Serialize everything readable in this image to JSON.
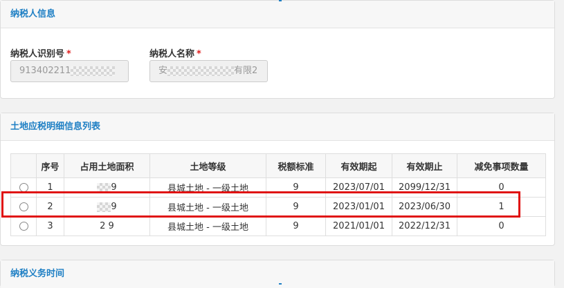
{
  "taxpayer_info": {
    "title": "纳税人信息",
    "id_label": "纳税人识别号",
    "id_value": "913402211",
    "name_label": "纳税人名称",
    "name_prefix": "安",
    "name_suffix": "有限2",
    "required_mark": "*"
  },
  "land_list": {
    "title": "土地应税明细信息列表",
    "columns": [
      "",
      "序号",
      "占用土地面积",
      "土地等级",
      "税额标准",
      "有效期起",
      "有效期止",
      "减免事项数量"
    ],
    "rows": [
      {
        "seq": "1",
        "area": "9",
        "grade": "县城土地 - 一级土地",
        "rate": "9",
        "start": "2023/07/01",
        "end": "2099/12/31",
        "count": "0"
      },
      {
        "seq": "2",
        "area": "9",
        "grade": "县城土地 - 一级土地",
        "rate": "9",
        "start": "2023/01/01",
        "end": "2023/06/30",
        "count": "1"
      },
      {
        "seq": "3",
        "area": "2 9",
        "grade": "县城土地 - 一级土地",
        "rate": "9",
        "start": "2021/01/01",
        "end": "2022/12/31",
        "count": "0"
      }
    ]
  },
  "tax_obligation": {
    "title": "纳税义务时间"
  },
  "colors": {
    "accent": "#1e7fc4",
    "highlight": "#e01010",
    "required": "#e02020"
  }
}
